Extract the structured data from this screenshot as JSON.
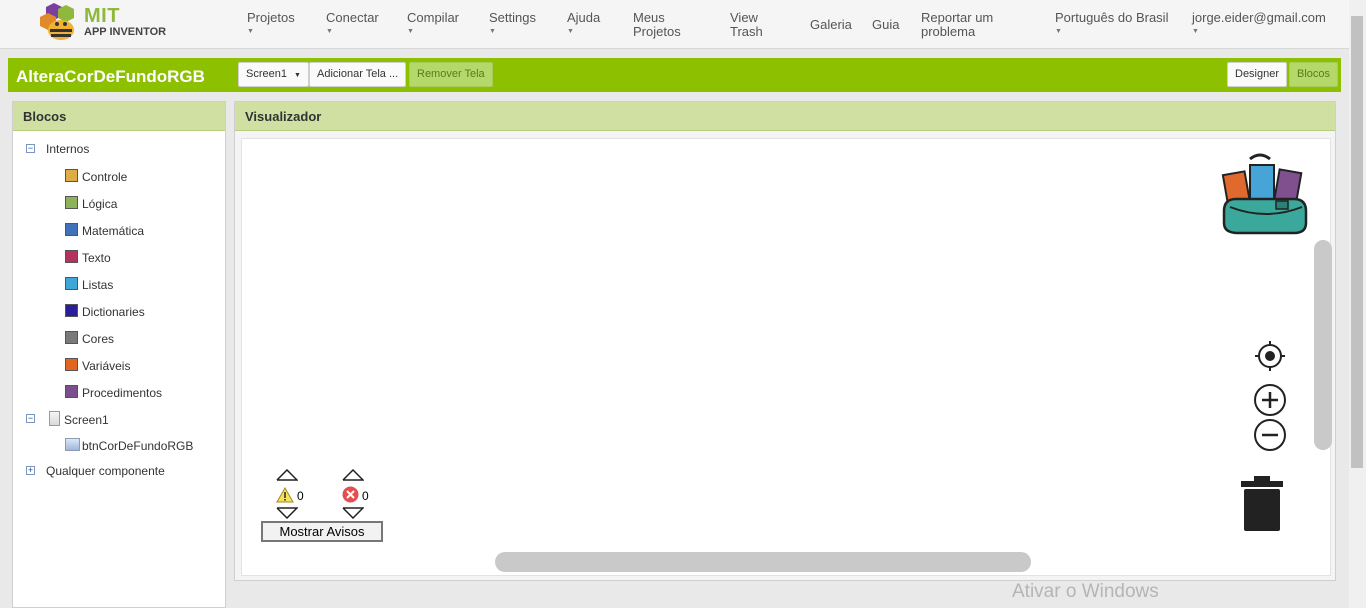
{
  "brand": {
    "logo_text": "MIT",
    "logo_sub": "APP INVENTOR",
    "accent": "#8dc100"
  },
  "nav": {
    "items": [
      {
        "label": "Projetos",
        "has_caret": true
      },
      {
        "label": "Conectar",
        "has_caret": true
      },
      {
        "label": "Compilar",
        "has_caret": true
      },
      {
        "label": "Settings",
        "has_caret": true
      },
      {
        "label": "Ajuda",
        "has_caret": true
      },
      {
        "label": "Meus\nProjetos",
        "has_caret": false
      },
      {
        "label": "View\nTrash",
        "has_caret": false
      },
      {
        "label": "Galeria",
        "has_caret": false
      },
      {
        "label": "Guia",
        "has_caret": false
      },
      {
        "label": "Reportar um\nproblema",
        "has_caret": false
      },
      {
        "label": "Português do Brasil",
        "has_caret": true
      },
      {
        "label": "jorge.eider@gmail.com",
        "has_caret": true
      }
    ]
  },
  "project": {
    "name": "AlteraCorDeFundoRGB",
    "screen_select": "Screen1",
    "add_screen": "Adicionar Tela ...",
    "remove_screen": "Remover Tela",
    "designer": "Designer",
    "blocks": "Blocos"
  },
  "blocks_panel": {
    "title": "Blocos",
    "builtin_label": "Internos",
    "builtin": [
      {
        "label": "Controle",
        "color": "#dfad45"
      },
      {
        "label": "Lógica",
        "color": "#8cb35c"
      },
      {
        "label": "Matemática",
        "color": "#3f72b8"
      },
      {
        "label": "Texto",
        "color": "#b5325e"
      },
      {
        "label": "Listas",
        "color": "#3fa6d8"
      },
      {
        "label": "Dictionaries",
        "color": "#2a1e9b"
      },
      {
        "label": "Cores",
        "color": "#7a7a7a"
      },
      {
        "label": "Variáveis",
        "color": "#e0661f"
      },
      {
        "label": "Procedimentos",
        "color": "#7b4f8e"
      }
    ],
    "screen_label": "Screen1",
    "component_label": "btnCorDeFundoRGB",
    "any_component": "Qualquer componente"
  },
  "viewer": {
    "title": "Visualizador",
    "warnings_count": "0",
    "errors_count": "0",
    "show_warnings": "Mostrar Avisos"
  },
  "os": {
    "watermark": "Ativar o Windows"
  }
}
